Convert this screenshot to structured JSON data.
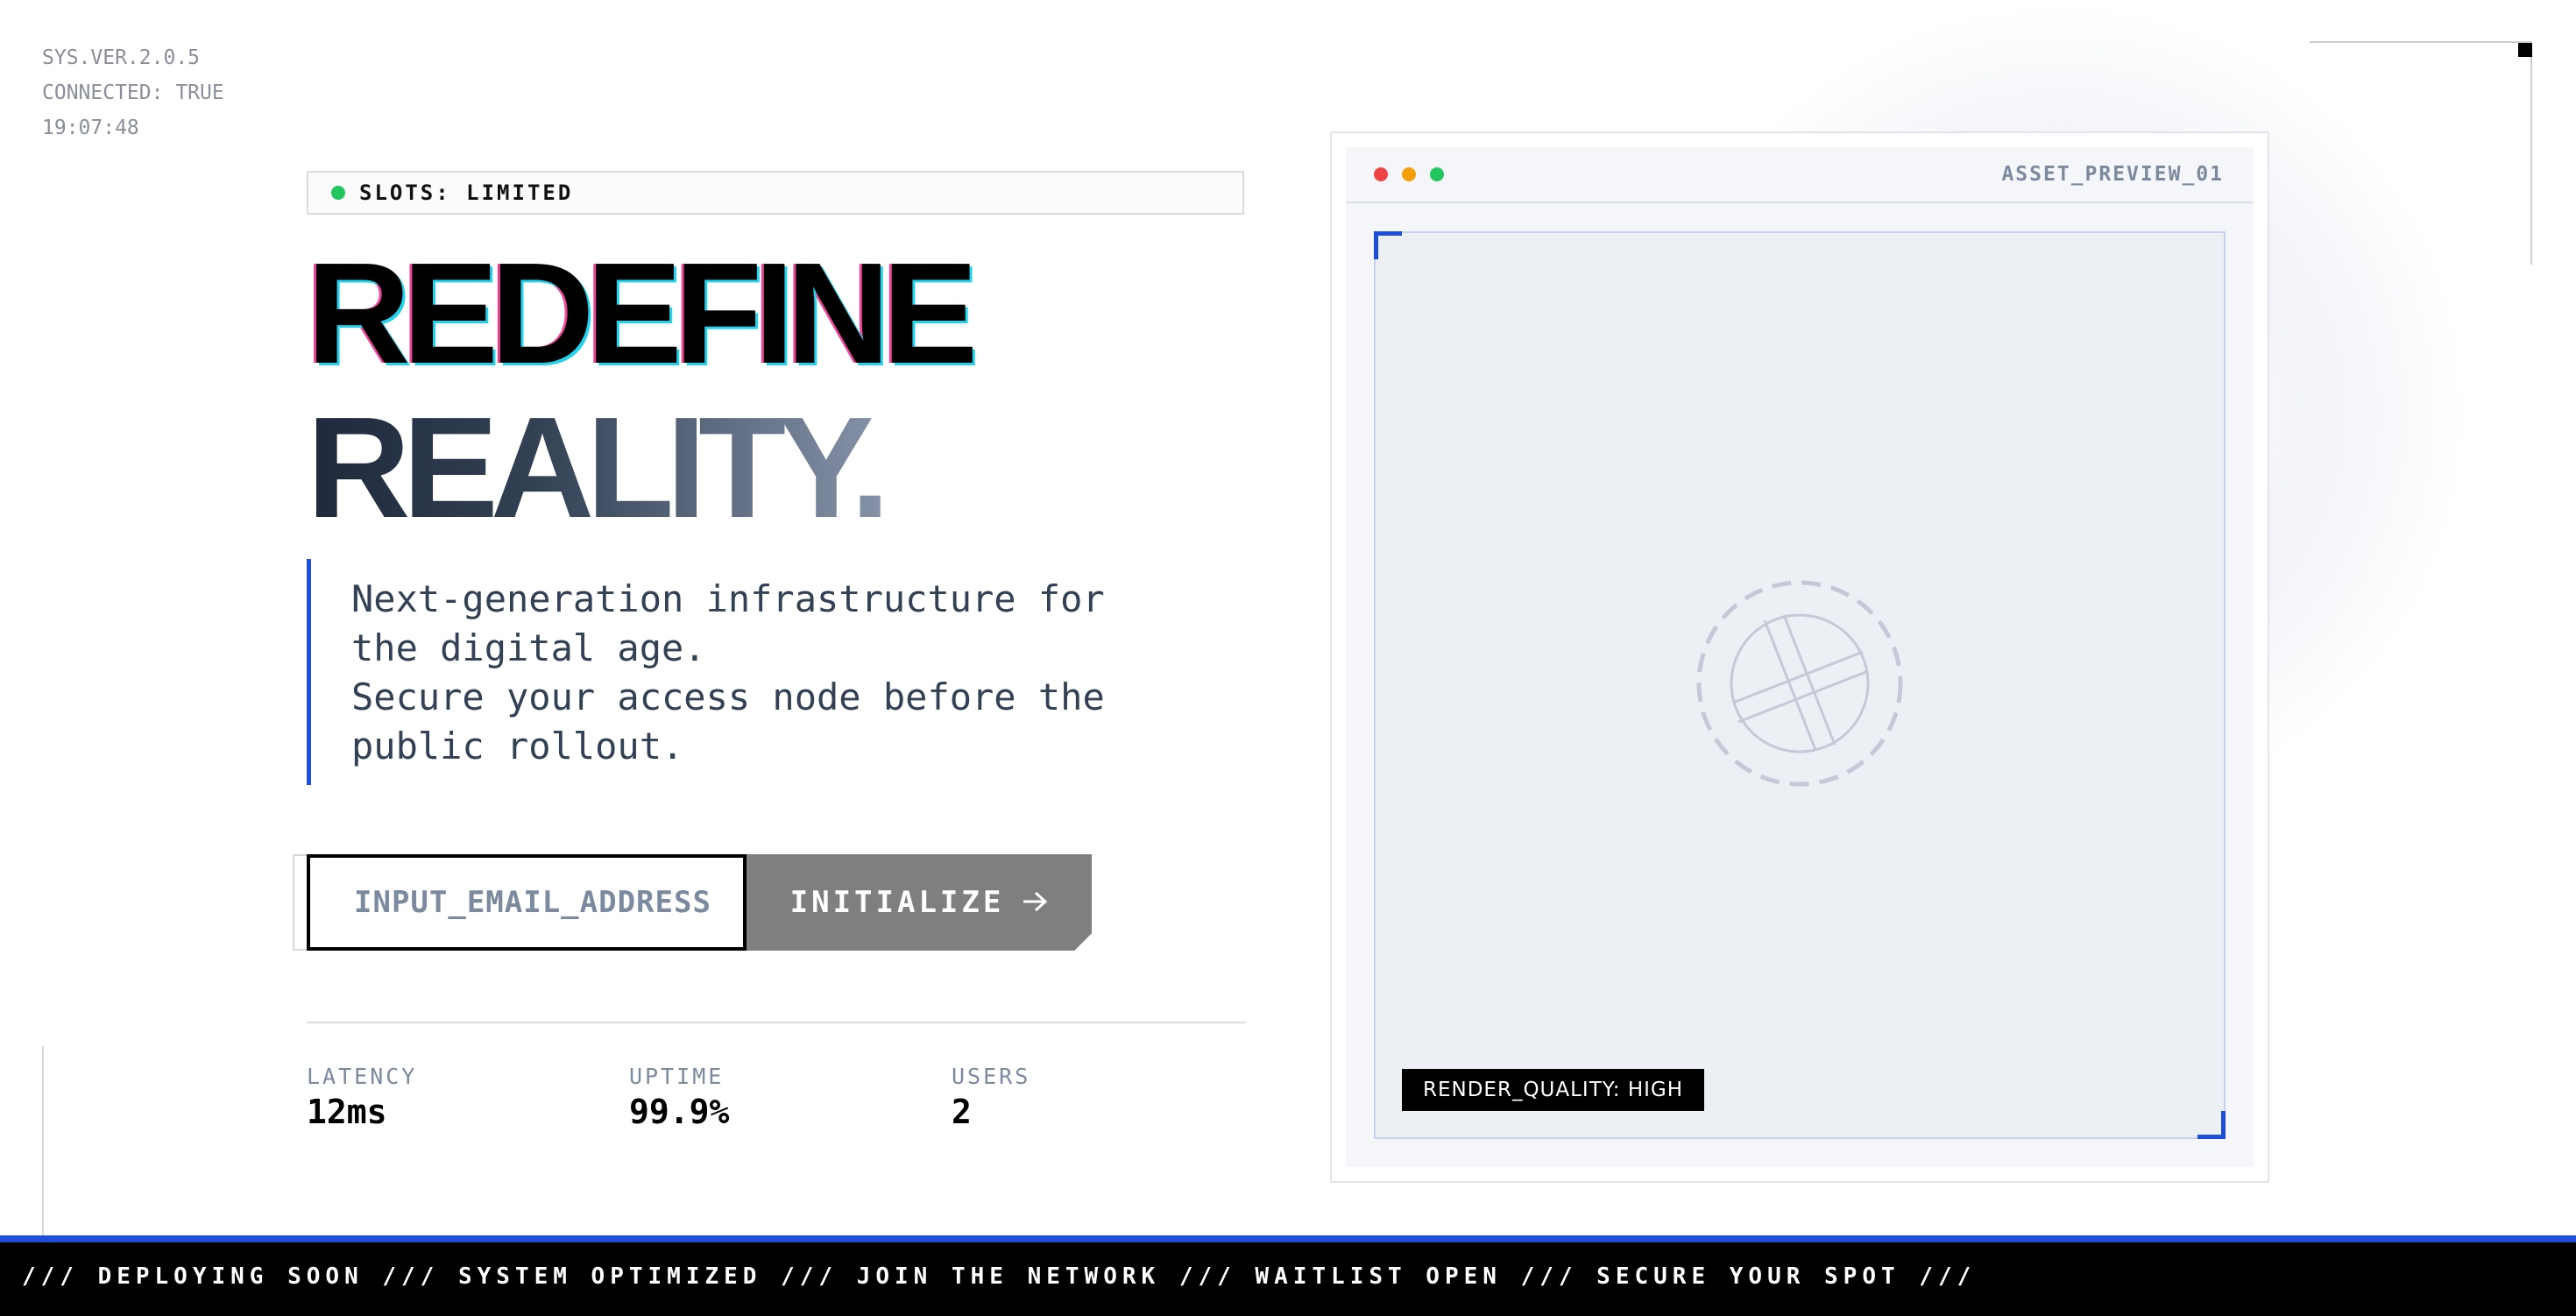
{
  "system": {
    "version": "SYS.VER.2.0.5",
    "connection": "CONNECTED: TRUE",
    "clock": "19:07:48"
  },
  "badge": {
    "text": "SLOTS: LIMITED",
    "status_color": "#22c55e"
  },
  "headline": {
    "line1": "REDEFINE",
    "line2": "REALITY."
  },
  "description": {
    "lines": [
      "Next-generation infrastructure for",
      "the digital age.",
      "Secure your access node before the",
      "public rollout."
    ]
  },
  "form": {
    "email_placeholder": "INPUT_EMAIL_ADDRESS",
    "submit_label": "INITIALIZE",
    "submit_icon": "arrow-right-icon"
  },
  "stats": [
    {
      "label": "LATENCY",
      "value": "12ms"
    },
    {
      "label": "UPTIME",
      "value": "99.9%"
    },
    {
      "label": "USERS",
      "value": "2"
    }
  ],
  "preview": {
    "title": "ASSET_PREVIEW_01",
    "window_controls": [
      "#ef4444",
      "#f59e0b",
      "#22c55e"
    ],
    "placeholder_icon": "image-placeholder-icon",
    "quality_label": "RENDER_QUALITY: HIGH"
  },
  "ticker": {
    "text": "OT /// DEPLOYING SOON /// SYSTEM OPTIMIZED /// JOIN THE NETWORK /// WAITLIST OPEN /// SECURE YOUR SPOT ///"
  },
  "colors": {
    "accent": "#1d4ed8",
    "text_muted": "#7c8aa0",
    "button_bg": "#7f7f7f"
  }
}
